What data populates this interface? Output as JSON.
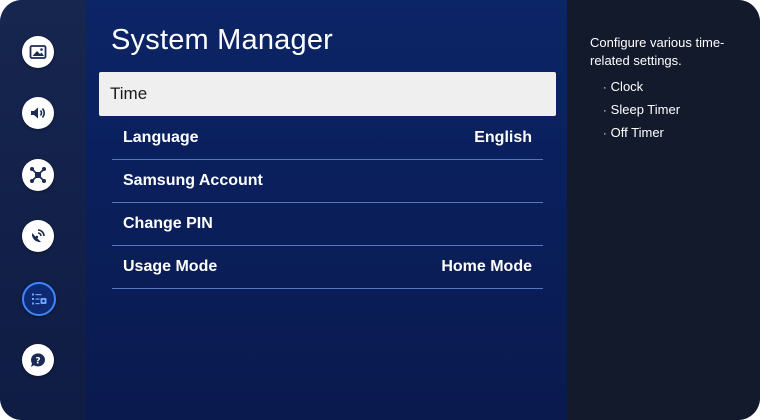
{
  "page": {
    "title": "System Manager"
  },
  "sidebar": {
    "items": [
      {
        "icon": "picture-icon",
        "active": false
      },
      {
        "icon": "sound-icon",
        "active": false
      },
      {
        "icon": "connection-icon",
        "active": false
      },
      {
        "icon": "broadcasting-icon",
        "active": false
      },
      {
        "icon": "general-settings-icon",
        "active": true
      },
      {
        "icon": "support-icon",
        "active": false
      }
    ]
  },
  "menu": {
    "items": [
      {
        "label": "Time",
        "value": "",
        "selected": true
      },
      {
        "label": "Language",
        "value": "English",
        "selected": false
      },
      {
        "label": "Samsung Account",
        "value": "",
        "selected": false
      },
      {
        "label": "Change PIN",
        "value": "",
        "selected": false
      },
      {
        "label": "Usage Mode",
        "value": "Home Mode",
        "selected": false
      }
    ]
  },
  "info": {
    "description": "Configure various time-related settings.",
    "bullets": [
      "Clock",
      "Sleep Timer",
      "Off Timer"
    ],
    "bullet_symbol": "·"
  },
  "colors": {
    "accent": "#3d86ff",
    "selected_row": "#efefef",
    "main_bg": "#0a1f5c",
    "info_bg": "#131a2c"
  }
}
